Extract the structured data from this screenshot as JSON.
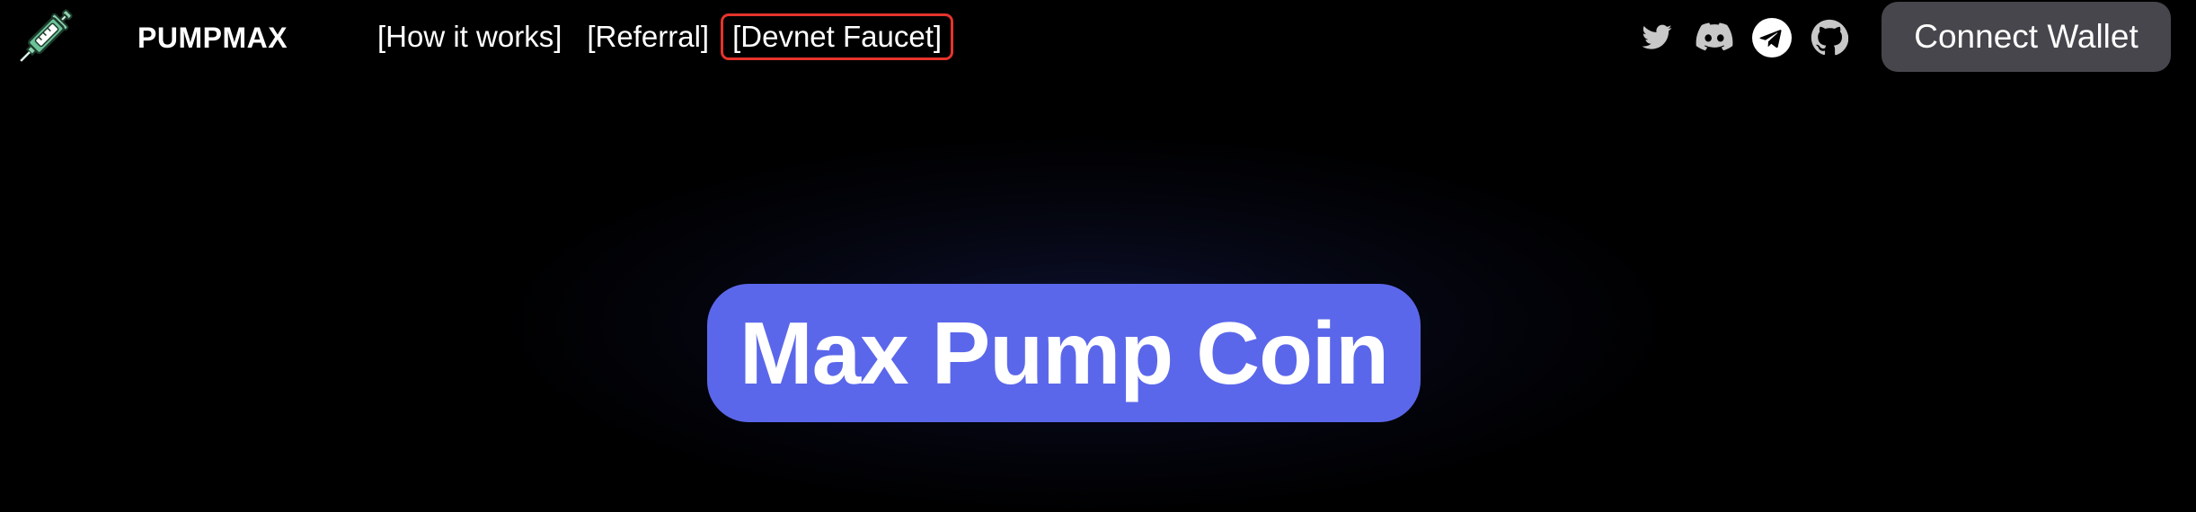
{
  "brand": {
    "name": "PUMPMAX",
    "logo_icon": "syringe-icon"
  },
  "nav": {
    "links": [
      {
        "label": "[How it works]"
      },
      {
        "label": "[Referral]"
      },
      {
        "label": "[Devnet Faucet]",
        "highlighted": true
      }
    ]
  },
  "socials": {
    "icons": [
      "twitter-icon",
      "discord-icon",
      "telegram-icon",
      "github-icon"
    ]
  },
  "connect_wallet": {
    "label": "Connect Wallet"
  },
  "hero": {
    "title": "Max Pump Coin"
  },
  "colors": {
    "background": "#000000",
    "accent": "#5b67ea",
    "button_bg": "#46464c",
    "highlight_outline": "#e5342c",
    "social_icon": "#c8c8c8",
    "logo_green": "#6cc398"
  }
}
